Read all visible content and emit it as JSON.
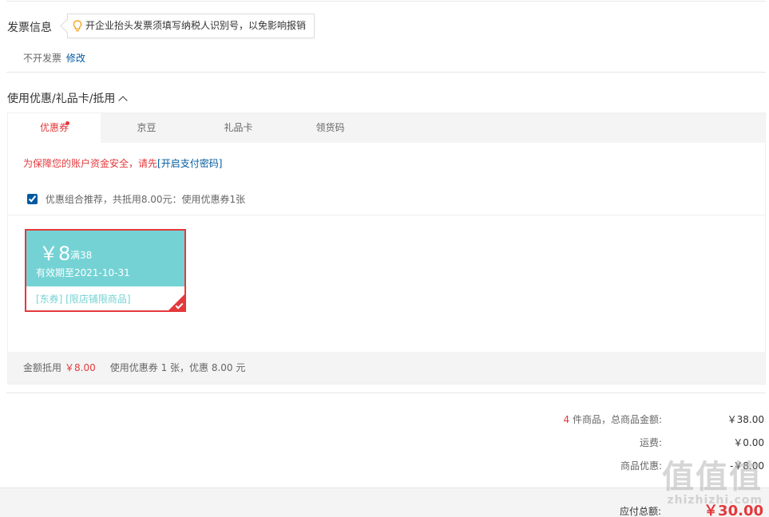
{
  "invoice": {
    "title": "发票信息",
    "tip": "开企业抬头发票须填写纳税人识别号，以免影响报销",
    "status": "不开发票",
    "modify_label": "修改"
  },
  "discount": {
    "title": "使用优惠/礼品卡/抵用",
    "tabs": [
      {
        "label": "优惠券"
      },
      {
        "label": "京豆"
      },
      {
        "label": "礼品卡"
      },
      {
        "label": "领货码"
      }
    ],
    "security_msg": "为保障您的账户资金安全，请先",
    "security_link": "[开启支付密码]",
    "combo_text": "优惠组合推荐，共抵用8.00元：使用优惠券1张",
    "coupon": {
      "amount": "￥8",
      "min_spend": "满38",
      "expire": "有效期至2021-10-31",
      "tags": "[东券]  [限店铺限商品]"
    },
    "amount_label": "金额抵用",
    "amount_value": "￥8.00",
    "amount_detail": "使用优惠券 1 张，优惠 8.00 元"
  },
  "summary": {
    "item_count": "4",
    "items_label": "件商品，总商品金额:",
    "items_value": "￥38.00",
    "shipping_label": "运费:",
    "shipping_value": "￥0.00",
    "discount_label": "商品优惠:",
    "discount_value": "-￥8.00",
    "pay_label": "应付总额:",
    "pay_value": "￥30.00"
  },
  "watermark": {
    "big": "值值值",
    "small": "zhizhizhi.com"
  },
  "colors": {
    "accent_red": "#e4393c",
    "link_blue": "#005aa0",
    "coupon_teal": "#74d2d4"
  }
}
